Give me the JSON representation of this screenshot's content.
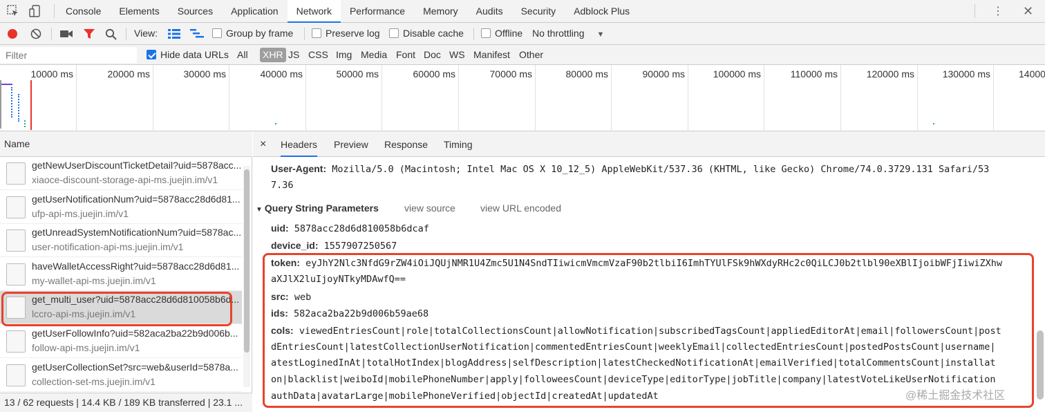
{
  "devtools_tabs": [
    "Console",
    "Elements",
    "Sources",
    "Application",
    "Network",
    "Performance",
    "Memory",
    "Audits",
    "Security",
    "Adblock Plus"
  ],
  "active_tab": "Network",
  "toolbar": {
    "view_label": "View:",
    "group_by_frame": "Group by frame",
    "preserve_log": "Preserve log",
    "disable_cache": "Disable cache",
    "offline": "Offline",
    "throttling": "No throttling"
  },
  "filterbar": {
    "placeholder": "Filter",
    "hide_data_urls": "Hide data URLs",
    "types": [
      "All",
      "XHR",
      "JS",
      "CSS",
      "Img",
      "Media",
      "Font",
      "Doc",
      "WS",
      "Manifest",
      "Other"
    ],
    "selected_type": "XHR"
  },
  "timeline": {
    "ticks": [
      "10000 ms",
      "20000 ms",
      "30000 ms",
      "40000 ms",
      "50000 ms",
      "60000 ms",
      "70000 ms",
      "80000 ms",
      "90000 ms",
      "100000 ms",
      "110000 ms",
      "120000 ms",
      "130000 ms",
      "14000"
    ]
  },
  "requests": {
    "header": "Name",
    "items": [
      {
        "name": "getNewUserDiscountTicketDetail?uid=5878acc...",
        "domain": "xiaoce-discount-storage-api-ms.juejin.im/v1"
      },
      {
        "name": "getUserNotificationNum?uid=5878acc28d6d81...",
        "domain": "ufp-api-ms.juejin.im/v1"
      },
      {
        "name": "getUnreadSystemNotificationNum?uid=5878ac...",
        "domain": "user-notification-api-ms.juejin.im/v1"
      },
      {
        "name": "haveWalletAccessRight?uid=5878acc28d6d81...",
        "domain": "my-wallet-api-ms.juejin.im/v1"
      },
      {
        "name": "get_multi_user?uid=5878acc28d6d810058b6d...",
        "domain": "lccro-api-ms.juejin.im/v1"
      },
      {
        "name": "getUserFollowInfo?uid=582aca2ba22b9d006b...",
        "domain": "follow-api-ms.juejin.im/v1"
      },
      {
        "name": "getUserCollectionSet?src=web&userId=5878a...",
        "domain": "collection-set-ms.juejin.im/v1"
      }
    ],
    "selected_index": 4,
    "status": "13 / 62 requests | 14.4 KB / 189 KB transferred | 23.1 ..."
  },
  "detail": {
    "tabs": [
      "Headers",
      "Preview",
      "Response",
      "Timing"
    ],
    "active": "Headers",
    "close": "×",
    "user_agent_key": "User-Agent:",
    "user_agent_line1": "Mozilla/5.0 (Macintosh; Intel Mac OS X 10_12_5) AppleWebKit/537.36 (KHTML, like Gecko) Chrome/74.0.3729.131 Safari/53",
    "user_agent_line2": "7.36",
    "query_section": "Query String Parameters",
    "view_source": "view source",
    "view_url_encoded": "view URL encoded",
    "params": {
      "uid_key": "uid:",
      "uid": "5878acc28d6d810058b6dcaf",
      "device_id_key": "device_id:",
      "device_id": "1557907250567",
      "token_key": "token:",
      "token_line1": "eyJhY2Nlc3NfdG9rZW4iOiJQUjNMR1U4Zmc5U1N4SndTIiwicmVmcmVzaF90b2tlbiI6ImhTYUlFSk9hWXdyRHc2c0QiLCJ0b2tlbl90eXBlIjoibWFjIiwiZXhw",
      "token_line2": "aXJlX2luIjoyNTkyMDAwfQ==",
      "src_key": "src:",
      "src": "web",
      "ids_key": "ids:",
      "ids": "582aca2ba22b9d006b59ae68",
      "cols_key": "cols:",
      "cols_line1": "viewedEntriesCount|role|totalCollectionsCount|allowNotification|subscribedTagsCount|appliedEditorAt|email|followersCount|post",
      "cols_line2": "dEntriesCount|latestCollectionUserNotification|commentedEntriesCount|weeklyEmail|collectedEntriesCount|postedPostsCount|username|",
      "cols_line3": "atestLoginedInAt|totalHotIndex|blogAddress|selfDescription|latestCheckedNotificationAt|emailVerified|totalCommentsCount|installat",
      "cols_line4": "on|blacklist|weiboId|mobilePhoneNumber|apply|followeesCount|deviceType|editorType|jobTitle|company|latestVoteLikeUserNotification",
      "cols_line5": "authData|avatarLarge|mobilePhoneVerified|objectId|createdAt|updatedAt"
    }
  },
  "watermark": "@稀土掘金技术社区",
  "colors": {
    "accent": "#1a73e8",
    "highlight": "#e8432c",
    "record": "#e8332c"
  }
}
